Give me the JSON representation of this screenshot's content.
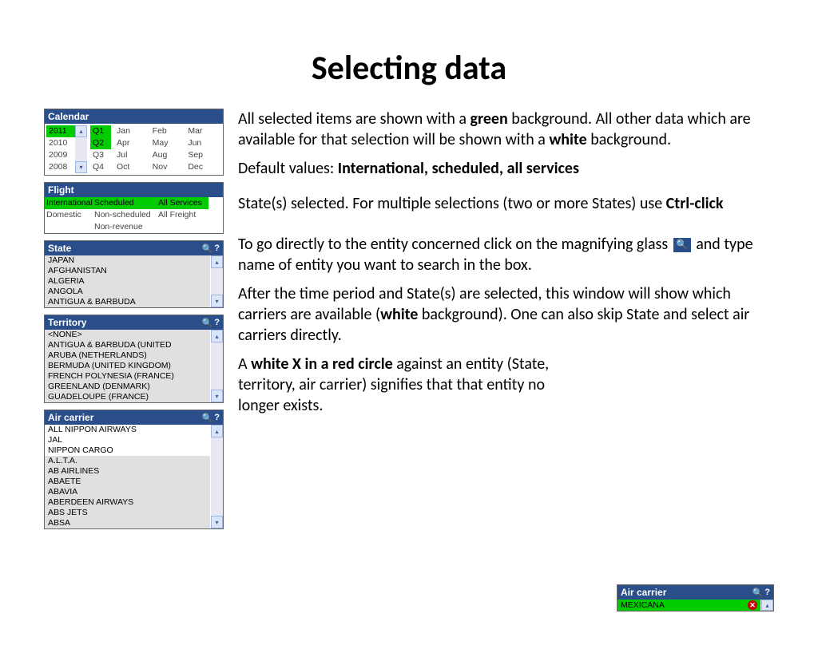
{
  "title": "Selecting data",
  "calendar": {
    "title": "Calendar",
    "years": [
      "2011",
      "2010",
      "2009",
      "2008"
    ],
    "year_selected_index": 0,
    "quarters": [
      "Q1",
      "Q2",
      "Q3",
      "Q4"
    ],
    "q_selected": [
      0,
      1
    ],
    "months": [
      "Jan",
      "Feb",
      "Mar",
      "Apr",
      "May",
      "Jun",
      "Jul",
      "Aug",
      "Sep",
      "Oct",
      "Nov",
      "Dec"
    ]
  },
  "flight": {
    "title": "Flight",
    "cells": [
      {
        "t": "International",
        "sel": true
      },
      {
        "t": "Scheduled",
        "sel": true
      },
      {
        "t": "All Services",
        "sel": true
      },
      {
        "t": "Domestic",
        "sel": false
      },
      {
        "t": "Non-scheduled",
        "sel": false
      },
      {
        "t": "All Freight",
        "sel": false
      },
      {
        "t": "",
        "sel": false
      },
      {
        "t": "Non-revenue",
        "sel": false
      },
      {
        "t": "",
        "sel": false
      }
    ]
  },
  "state": {
    "title": "State",
    "items": [
      "JAPAN",
      "AFGHANISTAN",
      "ALGERIA",
      "ANGOLA",
      "ANTIGUA & BARBUDA"
    ],
    "selected_index": 0
  },
  "territory": {
    "title": "Territory",
    "items": [
      "<NONE>",
      "ANTIGUA & BARBUDA (UNITED",
      "ARUBA (NETHERLANDS)",
      "BERMUDA (UNITED KINGDOM)",
      "FRENCH POLYNESIA (FRANCE)",
      "GREENLAND (DENMARK)",
      "GUADELOUPE (FRANCE)"
    ]
  },
  "aircarrier": {
    "title": "Air carrier",
    "items": [
      "ALL NIPPON AIRWAYS",
      "JAL",
      "NIPPON CARGO",
      "A.L.T.A.",
      "AB AIRLINES",
      "ABAETE",
      "ABAVIA",
      "ABERDEEN AIRWAYS",
      "ABS JETS",
      "ABSA"
    ]
  },
  "mini_carrier": {
    "title": "Air carrier",
    "item": "MEXICANA"
  },
  "text": {
    "p1a": "All selected items are shown with a ",
    "p1b": "green",
    "p1c": " background. All other data which are available for that selection will  be shown with a ",
    "p1d": "white",
    "p1e": " background.",
    "p2a": "Default values:  ",
    "p2b": "International, scheduled, all services",
    "p3a": "State(s) selected. For multiple selections (two or more States)  use ",
    "p3b": "Ctrl-click",
    "p4a": "To go directly to the entity concerned click on the magnifying glass ",
    "p4b": "  and type name of entity you want to search in the box.",
    "p5a": "After the time period and State(s) are selected, this window will show which carriers are available (",
    "p5b": "white",
    "p5c": " background). One can also skip State and select air carriers directly.",
    "p6a": "A ",
    "p6b": "white X in a red circle",
    "p6c": " against an entity (State, territory, air carrier) signifies that that entity no longer exists."
  }
}
